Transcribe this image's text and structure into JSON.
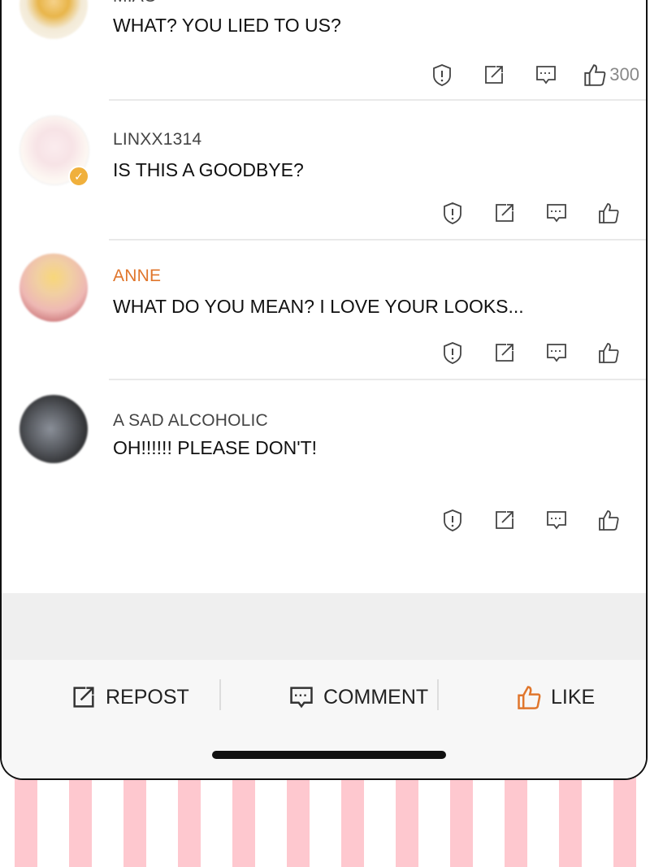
{
  "comments": [
    {
      "username": "MIAO",
      "text": "WHAT? YOU LIED TO US?",
      "likes": "300"
    },
    {
      "username": "LINXX1314",
      "text": "IS THIS A GOODBYE?",
      "likes": ""
    },
    {
      "username": "ANNE",
      "text": "WHAT DO YOU MEAN? I LOVE YOUR LOOKS...",
      "likes": ""
    },
    {
      "username": "A SAD ALCOHOLIC",
      "text": "OH!!!!!! PLEASE DON'T!",
      "likes": ""
    }
  ],
  "bottom_bar": {
    "repost_label": "REPOST",
    "comment_label": "COMMENT",
    "like_label": "LIKE"
  },
  "colors": {
    "accent_orange": "#e0762c",
    "verified_badge": "#f0b03c",
    "stripe_pink": "#fec8cf"
  },
  "icons": [
    "report-icon",
    "repost-icon",
    "comment-icon",
    "like-icon",
    "verified-badge-icon"
  ]
}
